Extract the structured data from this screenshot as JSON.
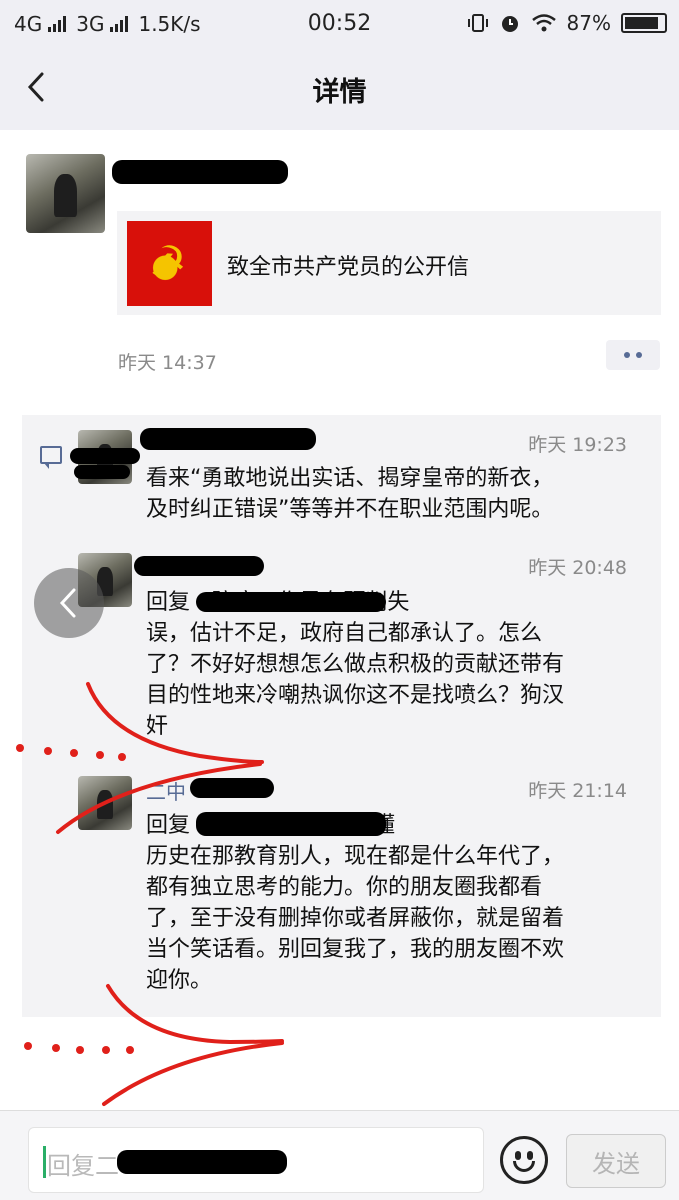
{
  "status_bar": {
    "network_left": "4G",
    "network_right": "3G",
    "speed": "1.5K/s",
    "time": "00:52",
    "battery": "87%",
    "battery_level": 0.87,
    "icons": [
      "signal-icon",
      "vibrate-icon",
      "alarm-icon",
      "wifi-icon",
      "battery-icon"
    ]
  },
  "header": {
    "title": "详情",
    "back_icon": "chevron-left-icon"
  },
  "post": {
    "link_title": "致全市共产党员的公开信",
    "time": "昨天 14:37"
  },
  "comments": [
    {
      "time": "昨天 19:23",
      "text_lines": [
        "看来“勇敢地说出实话、揭穿皇帝的新衣，",
        "及时纠正错误”等等并不在职业范围内呢。"
      ]
    },
    {
      "time": "昨天 20:48",
      "text_lines": [
        "回复                    : 防疫工作是有预判失",
        "误，估计不足，政府自己都承认了。怎么",
        "了？不好好想想怎么做点积极的贡献还带有",
        "目的性地来冷嘲热讽你这不是找喷么？狗汉",
        "奸"
      ]
    },
    {
      "name": "二中",
      "time": "昨天 21:14",
      "text_lines": [
        "回复                          不要老觉得只有你懂",
        "历史在那教育别人，现在都是什么年代了，",
        "都有独立思考的能力。你的朋友圈我都看",
        "了，至于没有删掉你或者屏蔽你，就是留着",
        "当个笑话看。别回复我了，我的朋友圈不欢",
        "迎你。"
      ]
    }
  ],
  "reply_bar": {
    "placeholder": "回复二",
    "send_label": "发送"
  },
  "colors": {
    "link_blue": "#576b95",
    "annotation_red": "#e0201a"
  }
}
